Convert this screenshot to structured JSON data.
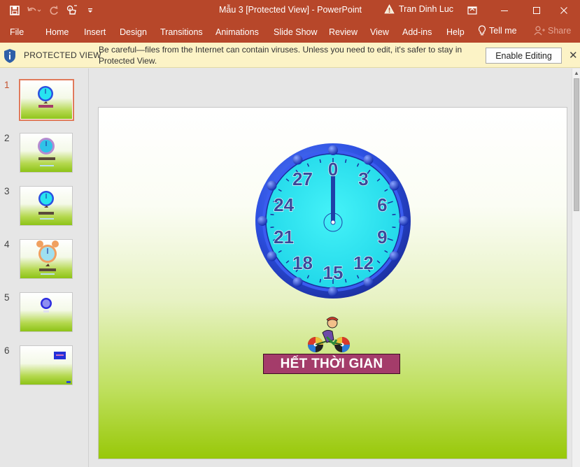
{
  "titlebar": {
    "document_title": "Mẫu 3 [Protected View]  -  PowerPoint",
    "user_name": "Tran Dinh Luc",
    "icons": [
      "save-icon",
      "undo-icon",
      "redo-icon",
      "touch-mode-icon",
      "customize-qat-icon"
    ]
  },
  "ribbon": {
    "tabs": [
      "File",
      "Home",
      "Insert",
      "Design",
      "Transitions",
      "Animations",
      "Slide Show",
      "Review",
      "View",
      "Add-ins",
      "Help"
    ],
    "tell_me": "Tell me",
    "share": "Share"
  },
  "protected_view": {
    "title": "PROTECTED VIEW",
    "message": "Be careful—files from the Internet can contain viruses. Unless you need to edit, it's safer to stay in Protected View.",
    "button": "Enable Editing"
  },
  "thumbnails": {
    "numbers": [
      "1",
      "2",
      "3",
      "4",
      "5",
      "6"
    ],
    "selected": 1
  },
  "slide": {
    "banner_text": "HẾT THỜI GIAN",
    "clock_numbers": [
      "0",
      "3",
      "6",
      "9",
      "12",
      "15",
      "18",
      "21",
      "24",
      "27"
    ]
  },
  "colors": {
    "ribbon": "#b7472a",
    "protected_bar": "#fcf3c6",
    "clock_face": "#27e3f0",
    "clock_rim": "#2c4fe0",
    "banner": "#a43c6a"
  }
}
